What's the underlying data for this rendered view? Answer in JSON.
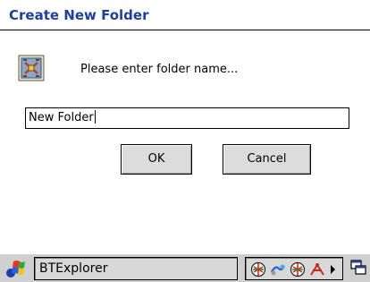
{
  "dialog": {
    "title": "Create New Folder",
    "prompt": "Please enter folder name...",
    "folder_name_value": "New Folder",
    "ok_label": "OK",
    "cancel_label": "Cancel",
    "icon": "folder-dialog-icon"
  },
  "taskbar": {
    "start_icon": "windows-flag-icon",
    "active_app": "BTExplorer",
    "tray_icons": [
      "bluetooth-icon",
      "connectivity-icon",
      "bluetooth-icon",
      "signal-icon",
      "expand-arrow-icon"
    ],
    "switch_icon": "task-switch-icon"
  },
  "colors": {
    "title_text": "#1f3f99",
    "taskbar_bg": "#cfcfcf",
    "button_bg": "#dcdcdc"
  }
}
